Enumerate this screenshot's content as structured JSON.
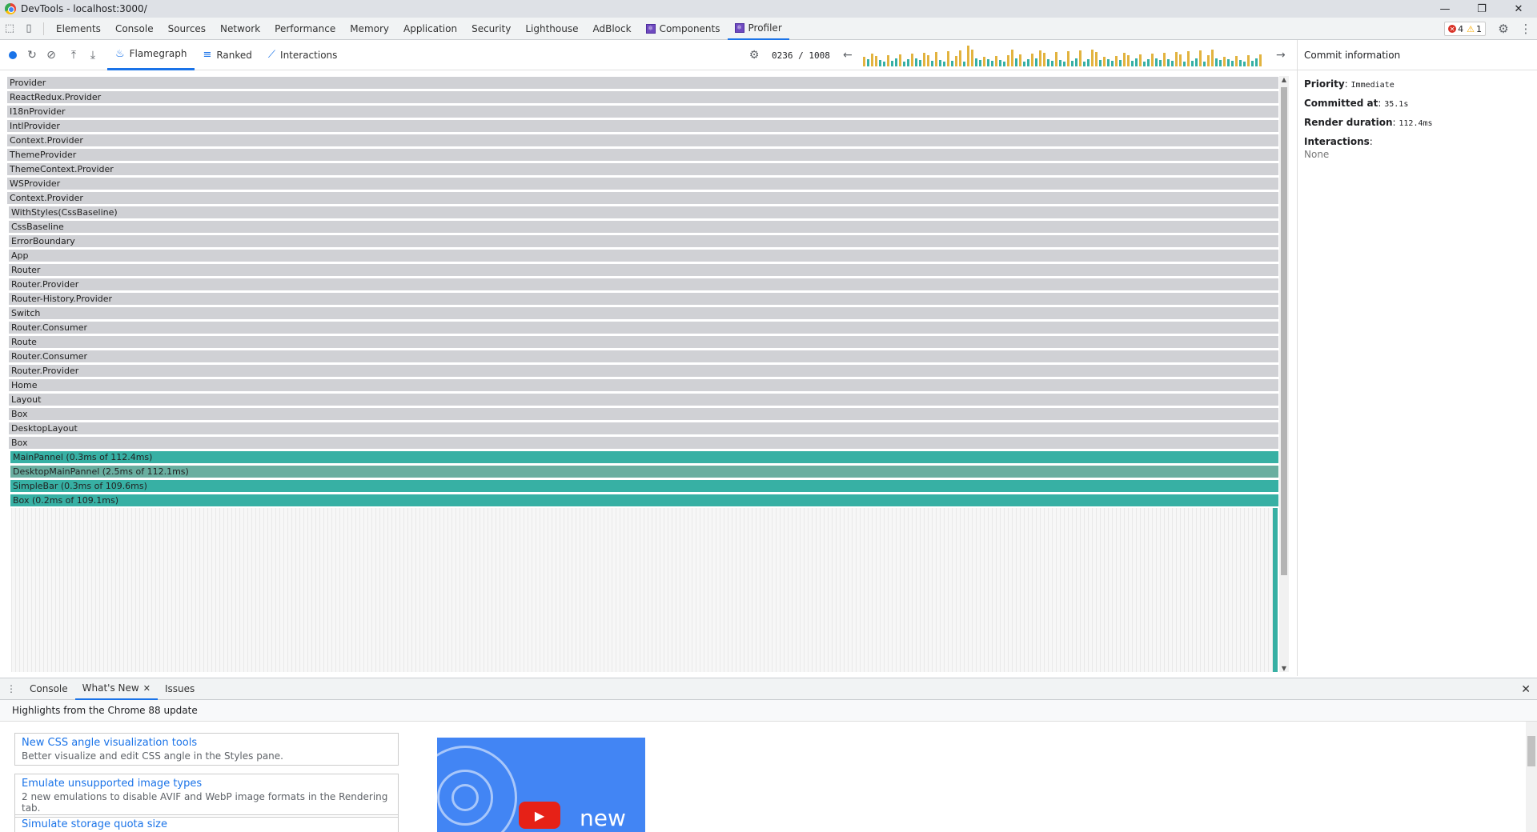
{
  "window": {
    "title": "DevTools - localhost:3000/",
    "controls": [
      "—",
      "❐",
      "✕"
    ]
  },
  "devtools_tabs": [
    {
      "label": "Elements"
    },
    {
      "label": "Console"
    },
    {
      "label": "Sources"
    },
    {
      "label": "Network"
    },
    {
      "label": "Performance"
    },
    {
      "label": "Memory"
    },
    {
      "label": "Application"
    },
    {
      "label": "Security"
    },
    {
      "label": "Lighthouse"
    },
    {
      "label": "AdBlock"
    },
    {
      "label": "Components",
      "react": true
    },
    {
      "label": "Profiler",
      "react": true,
      "active": true
    }
  ],
  "status": {
    "errors": "4",
    "warnings": "1"
  },
  "profiler": {
    "tabs": [
      {
        "label": "Flamegraph",
        "active": true,
        "icon": "flame-icon"
      },
      {
        "label": "Ranked",
        "icon": "ranked-icon"
      },
      {
        "label": "Interactions",
        "icon": "interactions-icon"
      }
    ],
    "commit_counter": "0236 / 1008"
  },
  "flamegraph": {
    "rows": [
      {
        "label": "Provider",
        "type": "gray"
      },
      {
        "label": "ReactRedux.Provider",
        "type": "gray"
      },
      {
        "label": "I18nProvider",
        "type": "gray"
      },
      {
        "label": "IntlProvider",
        "type": "gray"
      },
      {
        "label": "Context.Provider",
        "type": "gray"
      },
      {
        "label": "ThemeProvider",
        "type": "gray"
      },
      {
        "label": "ThemeContext.Provider",
        "type": "gray"
      },
      {
        "label": "WSProvider",
        "type": "gray"
      },
      {
        "label": "Context.Provider",
        "type": "gray"
      },
      {
        "label": "WithStyles(CssBaseline)",
        "type": "gray"
      },
      {
        "label": "CssBaseline",
        "type": "gray"
      },
      {
        "label": "ErrorBoundary",
        "type": "gray"
      },
      {
        "label": "App",
        "type": "gray"
      },
      {
        "label": "Router",
        "type": "gray"
      },
      {
        "label": "Router.Provider",
        "type": "gray"
      },
      {
        "label": "Router-History.Provider",
        "type": "gray"
      },
      {
        "label": "Switch",
        "type": "gray"
      },
      {
        "label": "Router.Consumer",
        "type": "gray"
      },
      {
        "label": "Route",
        "type": "gray"
      },
      {
        "label": "Router.Consumer",
        "type": "gray"
      },
      {
        "label": "Router.Provider",
        "type": "gray"
      },
      {
        "label": "Home",
        "type": "gray"
      },
      {
        "label": "Layout",
        "type": "gray"
      },
      {
        "label": "Box",
        "type": "gray"
      },
      {
        "label": "DesktopLayout",
        "type": "gray"
      },
      {
        "label": "Box",
        "type": "gray"
      },
      {
        "label": "MainPannel (0.3ms of 112.4ms)",
        "type": "teal"
      },
      {
        "label": "DesktopMainPannel (2.5ms of 112.1ms)",
        "type": "teal2"
      },
      {
        "label": "SimpleBar (0.3ms of 109.6ms)",
        "type": "teal"
      },
      {
        "label": "Box (0.2ms of 109.1ms)",
        "type": "teal"
      }
    ]
  },
  "commit_info": {
    "header": "Commit information",
    "priority_label": "Priority",
    "priority": "Immediate",
    "committed_label": "Committed at",
    "committed": "35.1s",
    "duration_label": "Render duration",
    "duration": "112.4ms",
    "interactions_label": "Interactions",
    "interactions": "None"
  },
  "drawer": {
    "tabs": [
      {
        "label": "Console"
      },
      {
        "label": "What's New",
        "active": true,
        "closable": true
      },
      {
        "label": "Issues"
      }
    ],
    "heading": "Highlights from the Chrome 88 update",
    "cards": [
      {
        "title": "New CSS angle visualization tools",
        "desc": "Better visualize and edit CSS angle in the Styles pane."
      },
      {
        "title": "Emulate unsupported image types",
        "desc": "2 new emulations to disable AVIF and WebP image formats in the Rendering tab."
      },
      {
        "title": "Simulate storage quota size",
        "desc": ""
      }
    ],
    "video_text": "new"
  },
  "colors": {
    "accent": "#1a73e8",
    "flame_gray": "#d0d1d5",
    "flame_teal": "#37b0a4",
    "commit_yellow": "#e2b33f",
    "commit_teal": "#37b0a4"
  }
}
